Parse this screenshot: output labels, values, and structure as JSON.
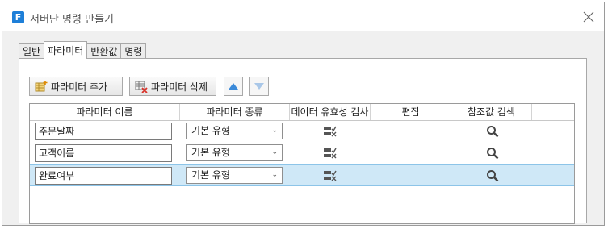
{
  "window": {
    "title": "서버단 명령 만들기",
    "app_icon_letter": "F"
  },
  "tabs": [
    {
      "label": "일반"
    },
    {
      "label": "파라미터"
    },
    {
      "label": "반환값"
    },
    {
      "label": "명령"
    }
  ],
  "toolbar": {
    "add_label": "파라미터 추가",
    "delete_label": "파라미터 삭제"
  },
  "grid": {
    "columns": [
      "파라미터 이름",
      "파라미터 종류",
      "데이터 유효성 검사",
      "편집",
      "참조값 검색"
    ],
    "rows": [
      {
        "name": "주문날짜",
        "type": "기본 유형",
        "selected": false
      },
      {
        "name": "고객이름",
        "type": "기본 유형",
        "selected": false
      },
      {
        "name": "완료여부",
        "type": "기본 유형",
        "selected": true
      }
    ]
  },
  "colors": {
    "accent": "#1e7fd8",
    "selected_row": "#cfe8f7",
    "arrow_up": "#3b8ad9",
    "arrow_down": "#a9c7e8"
  }
}
